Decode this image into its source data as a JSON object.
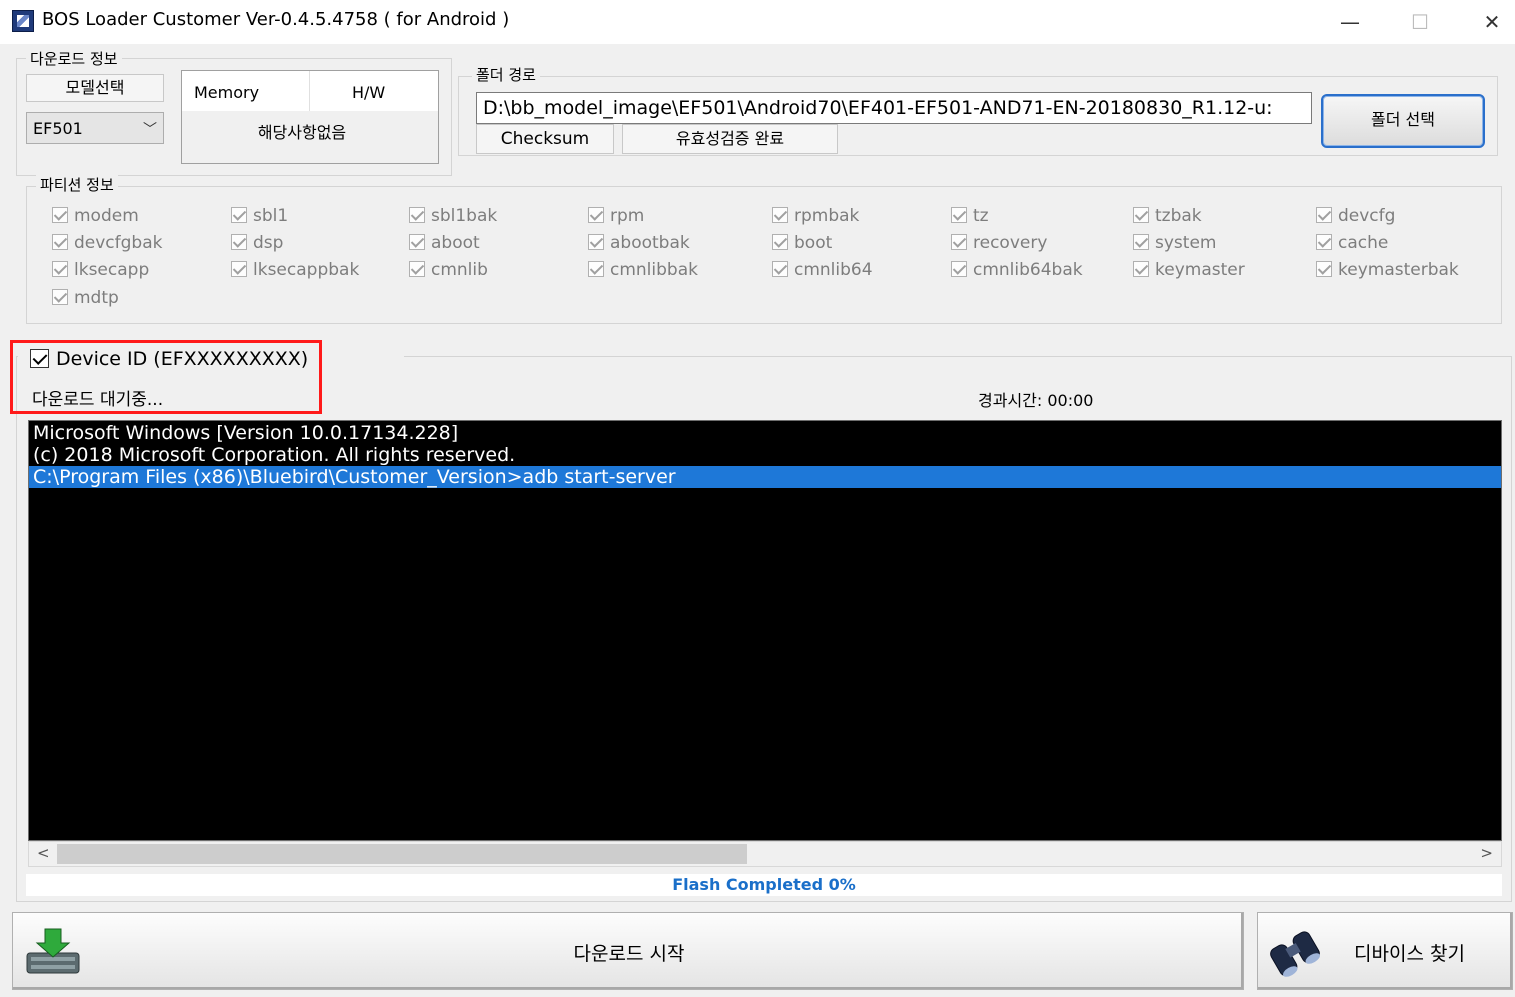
{
  "window": {
    "title": "BOS Loader Customer Ver-0.4.5.4758 ( for Android )",
    "minimize": "—",
    "maximize": "☐",
    "close": "✕"
  },
  "download_info": {
    "legend": "다운로드 정보",
    "model_label": "모델선택",
    "model_value": "EF501",
    "memory_label": "Memory",
    "hw_label": "H/W",
    "info_value": "해당사항없음"
  },
  "folder": {
    "legend": "폴더 경로",
    "path": "D:\\bb_model_image\\EF501\\Android70\\EF401-EF501-AND71-EN-20180830_R1.12-u:",
    "checksum_label": "Checksum",
    "checksum_value": "유효성검증 완료",
    "select_button": "폴더 선택"
  },
  "partitions": {
    "legend": "파티션 정보",
    "columns": [
      [
        "modem",
        "devcfgbak",
        "lksecapp",
        "mdtp"
      ],
      [
        "sbl1",
        "dsp",
        "lksecappbak"
      ],
      [
        "sbl1bak",
        "aboot",
        "cmnlib"
      ],
      [
        "rpm",
        "abootbak",
        "cmnlibbak"
      ],
      [
        "rpmbak",
        "boot",
        "cmnlib64"
      ],
      [
        "tz",
        "recovery",
        "cmnlib64bak"
      ],
      [
        "tzbak",
        "system",
        "keymaster"
      ],
      [
        "devcfg",
        "cache",
        "keymasterbak"
      ]
    ]
  },
  "device": {
    "id_label": "Device ID (EFXXXXXXXXX)",
    "status": "다운로드 대기중...",
    "elapsed": "경과시간: 00:00"
  },
  "console": {
    "lines": [
      "Microsoft Windows [Version 10.0.17134.228]",
      "(c) 2018 Microsoft Corporation. All rights reserved.",
      "C:\\Program Files (x86)\\Bluebird\\Customer_Version>adb start-server"
    ]
  },
  "scroll": {
    "left": "<",
    "right": ">"
  },
  "status": {
    "text": "Flash  Completed 0%"
  },
  "buttons": {
    "start_download": "다운로드 시작",
    "find_device": "디바이스 찾기"
  }
}
